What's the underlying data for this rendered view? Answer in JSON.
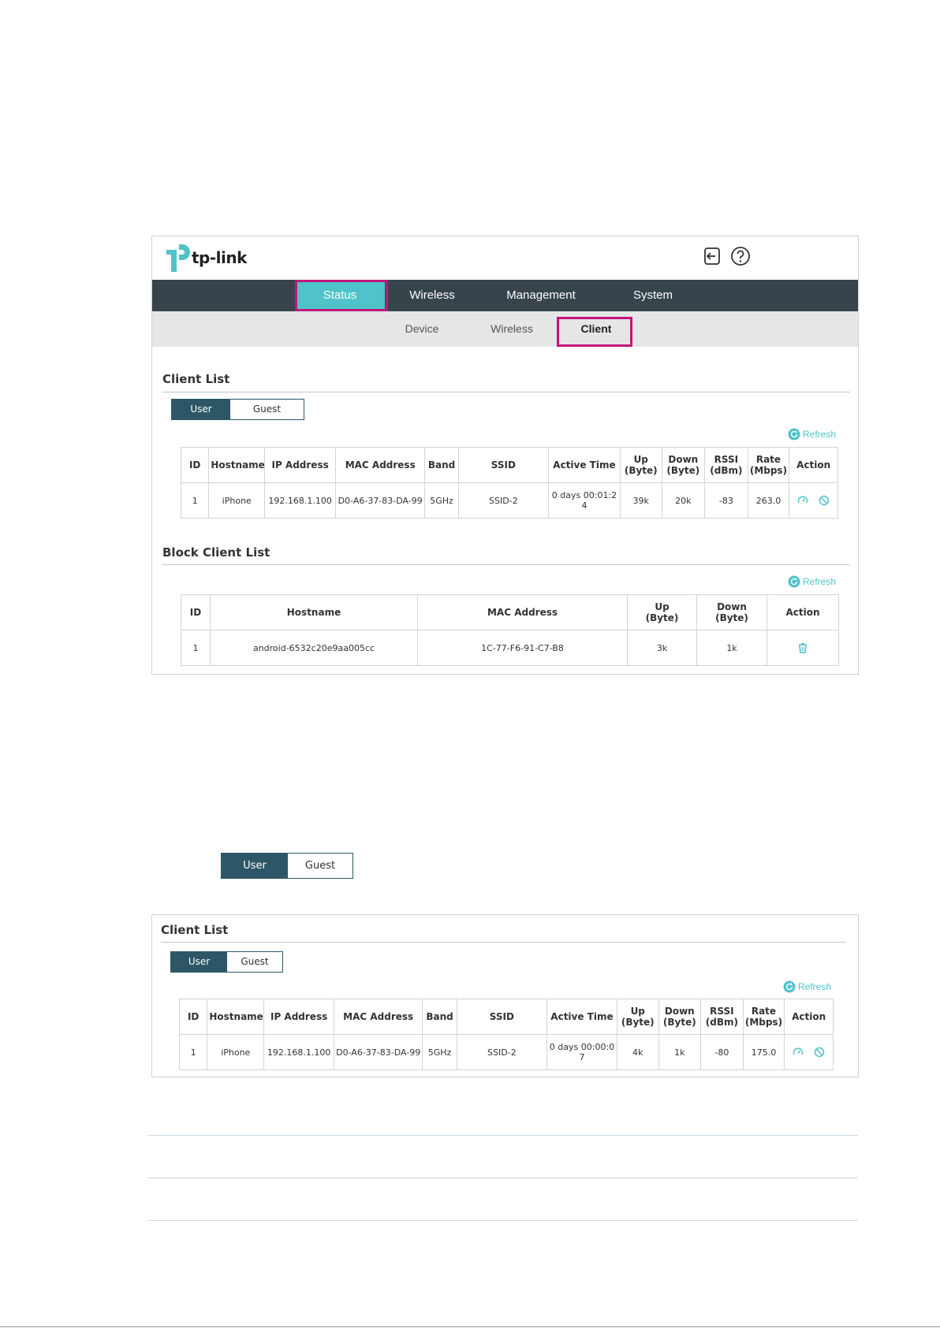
{
  "brand": {
    "logo_text": "tp-link",
    "accent": "#4fc3c9",
    "nav_bg": "#37444c",
    "highlight": "#c2177a",
    "segment_active": "#2d5766"
  },
  "header": {
    "icons": [
      "logout-icon",
      "help-icon"
    ]
  },
  "topnav": {
    "items": [
      {
        "label": "Status",
        "active": true
      },
      {
        "label": "Wireless",
        "active": false
      },
      {
        "label": "Management",
        "active": false
      },
      {
        "label": "System",
        "active": false
      }
    ]
  },
  "subnav": {
    "items": [
      {
        "label": "Device",
        "active": false
      },
      {
        "label": "Wireless",
        "active": false
      },
      {
        "label": "Client",
        "active": true
      }
    ]
  },
  "client_list": {
    "title": "Client List",
    "segment": {
      "user": "User",
      "guest": "Guest",
      "selected": "User"
    },
    "refresh": "Refresh",
    "headers": {
      "id": "ID",
      "hostname": "Hostname",
      "ip": "IP Address",
      "mac": "MAC Address",
      "band": "Band",
      "ssid": "SSID",
      "active_time": "Active Time",
      "up1": "Up",
      "up2": "(Byte)",
      "down1": "Down",
      "down2": "(Byte)",
      "rssi1": "RSSI",
      "rssi2": "(dBm)",
      "rate1": "Rate",
      "rate2": "(Mbps)",
      "action": "Action"
    },
    "rows": [
      {
        "id": "1",
        "hostname": "iPhone",
        "ip": "192.168.1.100",
        "mac": "D0-A6-37-83-DA-99",
        "band": "5GHz",
        "ssid": "SSID-2",
        "active_time_1": "0 days 00:01:2",
        "active_time_2": "4",
        "up": "39k",
        "down": "20k",
        "rssi": "-83",
        "rate": "263.0"
      }
    ]
  },
  "block_list": {
    "title": "Block Client List",
    "refresh": "Refresh",
    "headers": {
      "id": "ID",
      "hostname": "Hostname",
      "mac": "MAC Address",
      "up1": "Up",
      "up2": "(Byte)",
      "down1": "Down",
      "down2": "(Byte)",
      "action": "Action"
    },
    "rows": [
      {
        "id": "1",
        "hostname": "android-6532c20e9aa005cc",
        "mac": "1C-77-F6-91-C7-B8",
        "up": "3k",
        "down": "1k"
      }
    ]
  },
  "standalone_segment": {
    "user": "User",
    "guest": "Guest",
    "selected": "User"
  },
  "client_list_2": {
    "title": "Client List",
    "segment": {
      "user": "User",
      "guest": "Guest",
      "selected": "User"
    },
    "refresh": "Refresh",
    "headers": {
      "id": "ID",
      "hostname": "Hostname",
      "ip": "IP Address",
      "mac": "MAC Address",
      "band": "Band",
      "ssid": "SSID",
      "active_time": "Active Time",
      "up1": "Up",
      "up2": "(Byte)",
      "down1": "Down",
      "down2": "(Byte)",
      "rssi1": "RSSI",
      "rssi2": "(dBm)",
      "rate1": "Rate",
      "rate2": "(Mbps)",
      "action": "Action"
    },
    "rows": [
      {
        "id": "1",
        "hostname": "iPhone",
        "ip": "192.168.1.100",
        "mac": "D0-A6-37-83-DA-99",
        "band": "5GHz",
        "ssid": "SSID-2",
        "active_time_1": "0 days 00:00:0",
        "active_time_2": "7",
        "up": "4k",
        "down": "1k",
        "rssi": "-80",
        "rate": "175.0"
      }
    ]
  }
}
